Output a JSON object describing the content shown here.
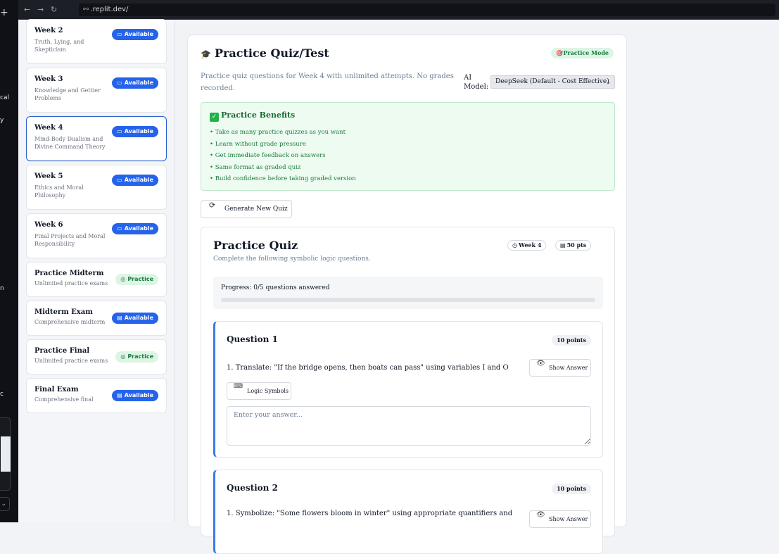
{
  "browser": {
    "url": ".replit.dev/"
  },
  "left_fragments": [
    "cal",
    "y",
    "n",
    "c"
  ],
  "weeks": [
    {
      "title": "Week 2",
      "subtitle": "Truth, Lying, and Skepticism",
      "badge": "Available",
      "badge_type": "available",
      "top": -1,
      "height": 64,
      "active": false
    },
    {
      "title": "Week 3",
      "subtitle": "Knowledge and Gettier Problems",
      "badge": "Available",
      "badge_type": "available",
      "active": false
    },
    {
      "title": "Week 4",
      "subtitle": "Mind-Body Dualism and Divine Command Theory",
      "badge": "Available",
      "badge_type": "available",
      "active": true
    },
    {
      "title": "Week 5",
      "subtitle": "Ethics and Moral Philosophy",
      "badge": "Available",
      "badge_type": "available",
      "active": false
    },
    {
      "title": "Week 6",
      "subtitle": "Final Projects and Moral Responsibility",
      "badge": "Available",
      "badge_type": "available",
      "active": false
    },
    {
      "title": "Practice Midterm",
      "subtitle": "Unlimited practice exams",
      "badge": "Practice",
      "badge_type": "practice",
      "active": false
    },
    {
      "title": "Midterm Exam",
      "subtitle": "Comprehensive midterm",
      "badge": "Available",
      "badge_type": "exam",
      "active": false
    },
    {
      "title": "Practice Final",
      "subtitle": "Unlimited practice exams",
      "badge": "Practice",
      "badge_type": "practice",
      "active": false
    },
    {
      "title": "Final Exam",
      "subtitle": "Comprehensive final",
      "badge": "Available",
      "badge_type": "exam",
      "active": false
    }
  ],
  "main": {
    "title": "Practice Quiz/Test",
    "mode_badge": "Practice Mode",
    "description": "Practice quiz questions for Week 4 with unlimited attempts. No grades recorded.",
    "ai_label": "AI Model:",
    "ai_model_selected": "DeepSeek (Default - Cost Effective)",
    "benefits_title": "Practice Benefits",
    "benefits": [
      "• Take as many practice quizzes as you want",
      "• Learn without grade pressure",
      "• Get immediate feedback on answers",
      "• Same format as graded quiz",
      "• Build confidence before taking graded version"
    ],
    "generate_button": "Generate New Quiz"
  },
  "quiz": {
    "title": "Practice Quiz",
    "subtitle": "Complete the following symbolic logic questions.",
    "week_pill": "Week 4",
    "points_pill": "50 pts",
    "progress_label": "Progress: 0/5 questions answered",
    "progress_value": 0,
    "questions": [
      {
        "title": "Question 1",
        "points": "10 points",
        "text": "1. Translate: \"If the bridge opens, then boats can pass\" using variables I and O",
        "show_answer": "Show Answer",
        "logic_symbols": "Logic Symbols",
        "placeholder": "Enter your answer..."
      },
      {
        "title": "Question 2",
        "points": "10 points",
        "text": "1. Symbolize: \"Some flowers bloom in winter\" using appropriate quantifiers and",
        "show_answer": "Show Answer"
      }
    ]
  },
  "colors": {
    "accent": "#2563eb",
    "practice_bg": "#dcf5e5",
    "practice_text": "#1d7a3d",
    "question_border": "#3b7be6"
  }
}
